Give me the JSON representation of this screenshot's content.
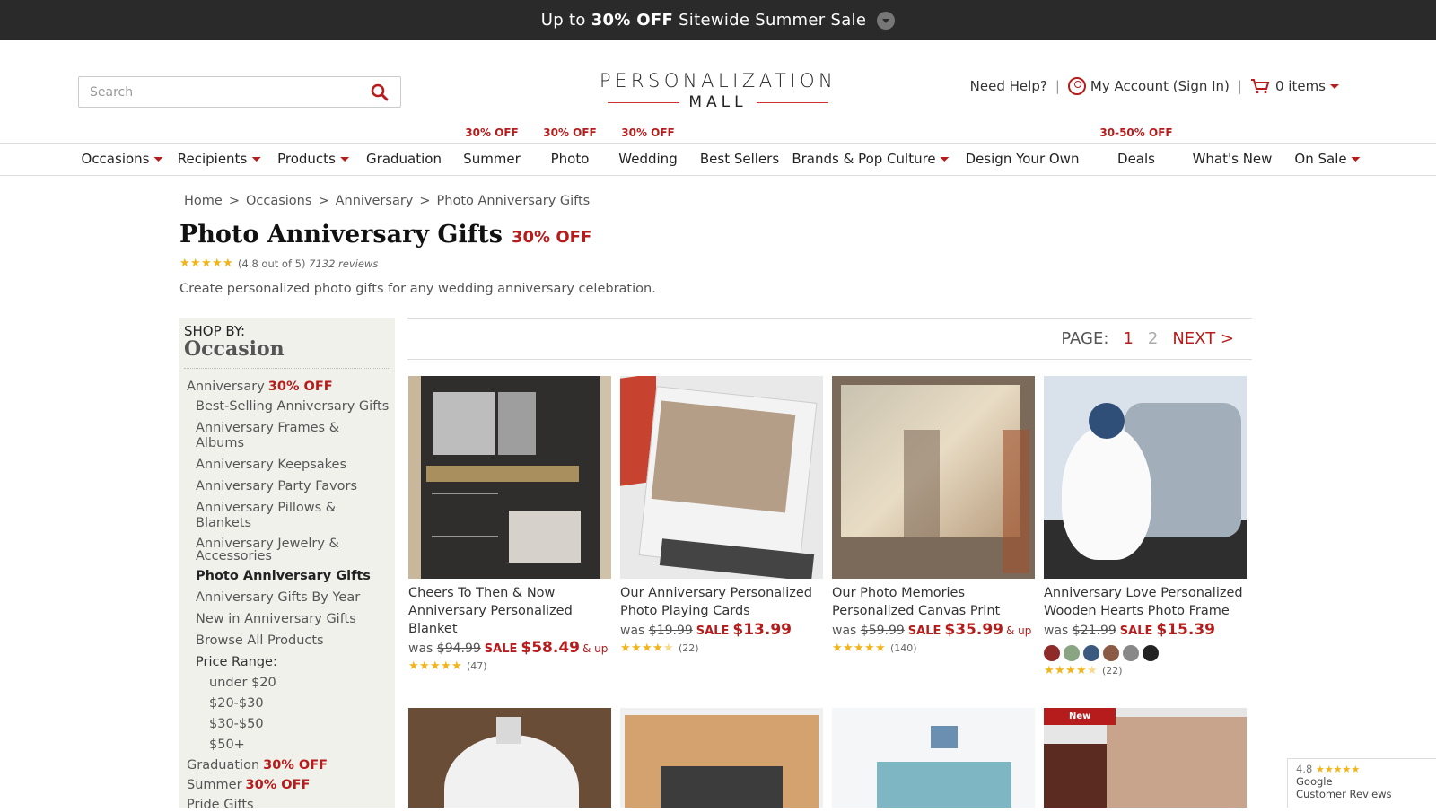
{
  "promo": {
    "prefix": "Up to",
    "highlight": "30% OFF",
    "suffix": "Sitewide Summer Sale"
  },
  "header": {
    "search_placeholder": "Search",
    "logo_top": "PERSONALIZATION",
    "logo_bottom": "MALL",
    "help": "Need Help?",
    "account": "My Account (Sign In)",
    "cart": "0 items"
  },
  "nav": {
    "badges": [
      "30% OFF",
      "30% OFF",
      "30% OFF",
      "30-50% OFF"
    ],
    "items": [
      "Occasions",
      "Recipients",
      "Products",
      "Graduation",
      "Summer",
      "Photo",
      "Wedding",
      "Best Sellers",
      "Brands & Pop Culture",
      "Design Your Own",
      "Deals",
      "What's New",
      "On Sale"
    ]
  },
  "breadcrumb": [
    "Home",
    "Occasions",
    "Anniversary",
    "Photo Anniversary Gifts"
  ],
  "breadcrumb_sep": ">",
  "page": {
    "title": "Photo Anniversary Gifts",
    "off": "30% OFF",
    "rating_text": "(4.8 out of 5)",
    "reviews_text": "7132 reviews",
    "rating": 4.8,
    "description": "Create personalized photo gifts for any wedding anniversary celebration."
  },
  "sidebar": {
    "shop_by": "SHOP BY:",
    "heading": "Occasion",
    "anniversary": "Anniversary",
    "anniversary_off": "30% OFF",
    "sub_items": [
      "Best-Selling Anniversary Gifts",
      "Anniversary Frames & Albums",
      "Anniversary Keepsakes",
      "Anniversary Party Favors",
      "Anniversary Pillows & Blankets",
      "Anniversary Jewelry & Accessories",
      "Photo Anniversary Gifts",
      "Anniversary Gifts By Year",
      "New in Anniversary Gifts",
      "Browse All Products"
    ],
    "price_label": "Price Range:",
    "prices": [
      "under $20",
      "$20-$30",
      "$30-$50",
      "$50+"
    ],
    "graduation": "Graduation",
    "graduation_off": "30% OFF",
    "summer": "Summer",
    "summer_off": "30% OFF",
    "pride": "Pride Gifts"
  },
  "pager": {
    "label": "PAGE:",
    "current": "1",
    "other": "2",
    "next": "NEXT >"
  },
  "products": [
    {
      "name": "Cheers To Then & Now Anniversary Personalized Blanket",
      "was_label": "was",
      "was": "$94.99",
      "sale_label": "SALE",
      "now": "$58.49",
      "up": "& up",
      "reviews": "(47)",
      "rating": 5.0
    },
    {
      "name": "Our Anniversary Personalized Photo Playing Cards",
      "was_label": "was",
      "was": "$19.99",
      "sale_label": "SALE",
      "now": "$13.99",
      "up": "",
      "reviews": "(22)",
      "rating": 4.5
    },
    {
      "name": "Our Photo Memories Personalized Canvas Print",
      "was_label": "was",
      "was": "$59.99",
      "sale_label": "SALE",
      "now": "$35.99",
      "up": "& up",
      "reviews": "(140)",
      "rating": 5.0
    },
    {
      "name": "Anniversary Love Personalized Wooden Hearts Photo Frame",
      "was_label": "was",
      "was": "$21.99",
      "sale_label": "SALE",
      "now": "$15.39",
      "up": "",
      "reviews": "(22)",
      "rating": 4.5,
      "swatches": [
        "#8e2a2a",
        "#8aa582",
        "#3c5a80",
        "#8b5a44",
        "#888888",
        "#222222"
      ]
    }
  ],
  "new_badge": "New",
  "google": {
    "score": "4.8",
    "line1": "Google",
    "line2": "Customer Reviews"
  },
  "colors": {
    "accent": "#b71c1c",
    "promo_bg": "#2a2a2a",
    "sidebar_bg": "#f1f1ec",
    "star": "#f1b51b"
  }
}
